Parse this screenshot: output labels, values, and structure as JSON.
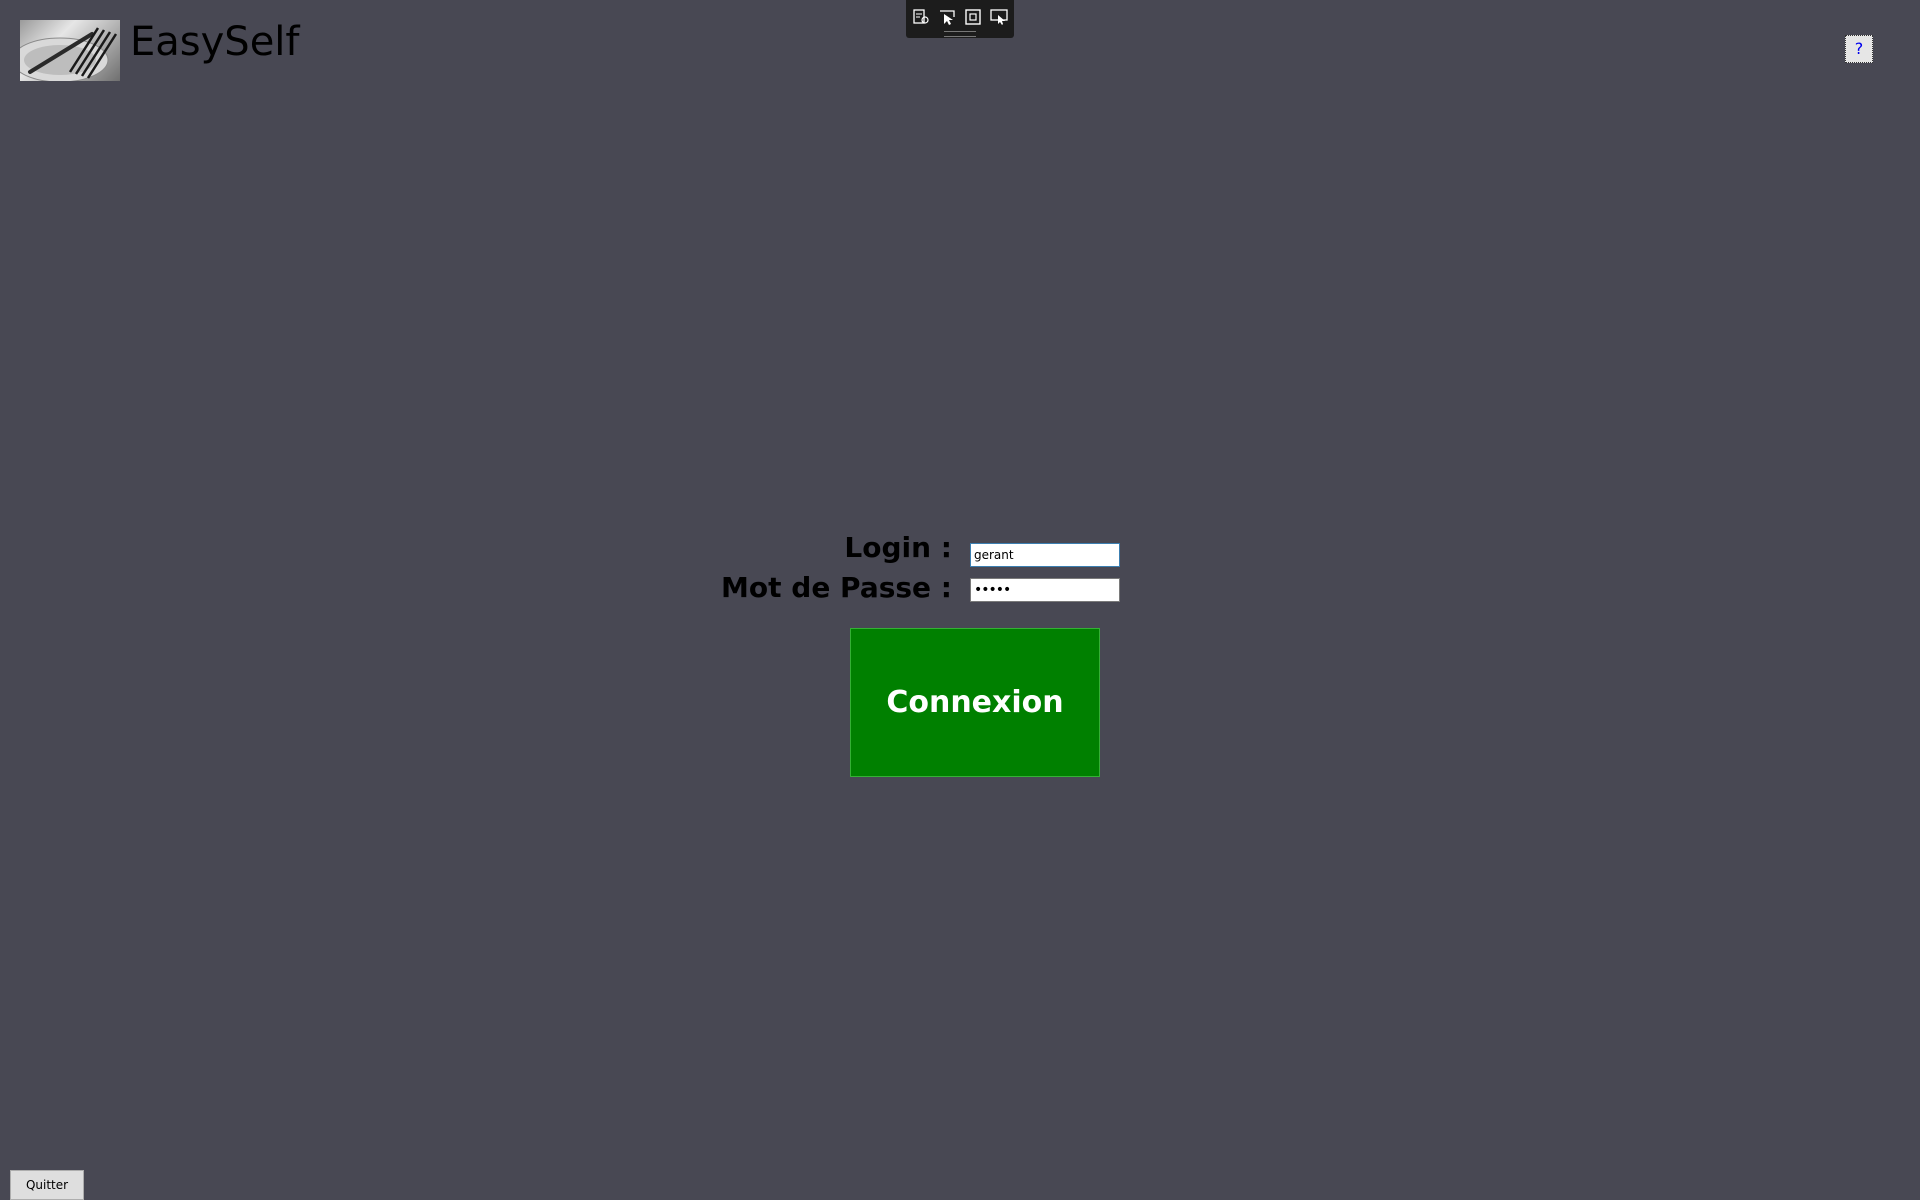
{
  "header": {
    "app_title": "EasySelf",
    "logo_icon": "fork-logo-icon"
  },
  "toolbar": {
    "icons": [
      "select-element-icon",
      "pointer-icon",
      "frame-icon",
      "screen-select-icon"
    ]
  },
  "help": {
    "label": "?"
  },
  "login_form": {
    "login_label": "Login :",
    "login_value": "gerant",
    "password_label": "Mot de Passe :",
    "password_value": "•••••",
    "submit_label": "Connexion"
  },
  "footer": {
    "quit_label": "Quitter"
  },
  "colors": {
    "background": "#484853",
    "connect_button": "#008000"
  }
}
